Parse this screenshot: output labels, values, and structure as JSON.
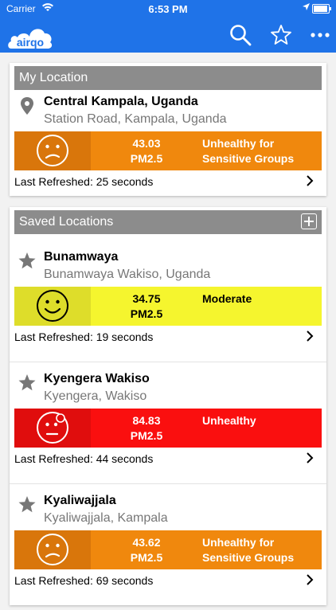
{
  "status_bar": {
    "carrier": "Carrier",
    "time": "6:53 PM"
  },
  "app": {
    "logo_text": "airqo"
  },
  "my_location": {
    "header": "My Location",
    "item": {
      "name": "Central Kampala, Uganda",
      "address": "Station Road, Kampala, Uganda",
      "value": "43.03",
      "unit": "PM2.5",
      "status_line1": "Unhealthy for",
      "status_line2": "Sensitive Groups",
      "refreshed": "Last Refreshed: 25 seconds",
      "color": "#f0880d",
      "face_color": "#d9760b"
    }
  },
  "saved_locations": {
    "header": "Saved Locations",
    "items": [
      {
        "name": "Bunamwaya",
        "address": "Bunamwaya Wakiso, Uganda",
        "value": "34.75",
        "unit": "PM2.5",
        "status_line1": "Moderate",
        "status_line2": "",
        "refreshed": "Last Refreshed: 19 seconds",
        "color": "#f5f52e",
        "face_color": "#dedd2a"
      },
      {
        "name": "Kyengera Wakiso",
        "address": "Kyengera, Wakiso",
        "value": "84.83",
        "unit": "PM2.5",
        "status_line1": "Unhealthy",
        "status_line2": "",
        "refreshed": "Last Refreshed: 44 seconds",
        "color": "#fa0f0f",
        "face_color": "#e00d0d"
      },
      {
        "name": "Kyaliwajjala",
        "address": "Kyaliwajjala, Kampala",
        "value": "43.62",
        "unit": "PM2.5",
        "status_line1": "Unhealthy for",
        "status_line2": "Sensitive Groups",
        "refreshed": "Last Refreshed: 69 seconds",
        "color": "#f0880d",
        "face_color": "#d9760b"
      }
    ]
  }
}
